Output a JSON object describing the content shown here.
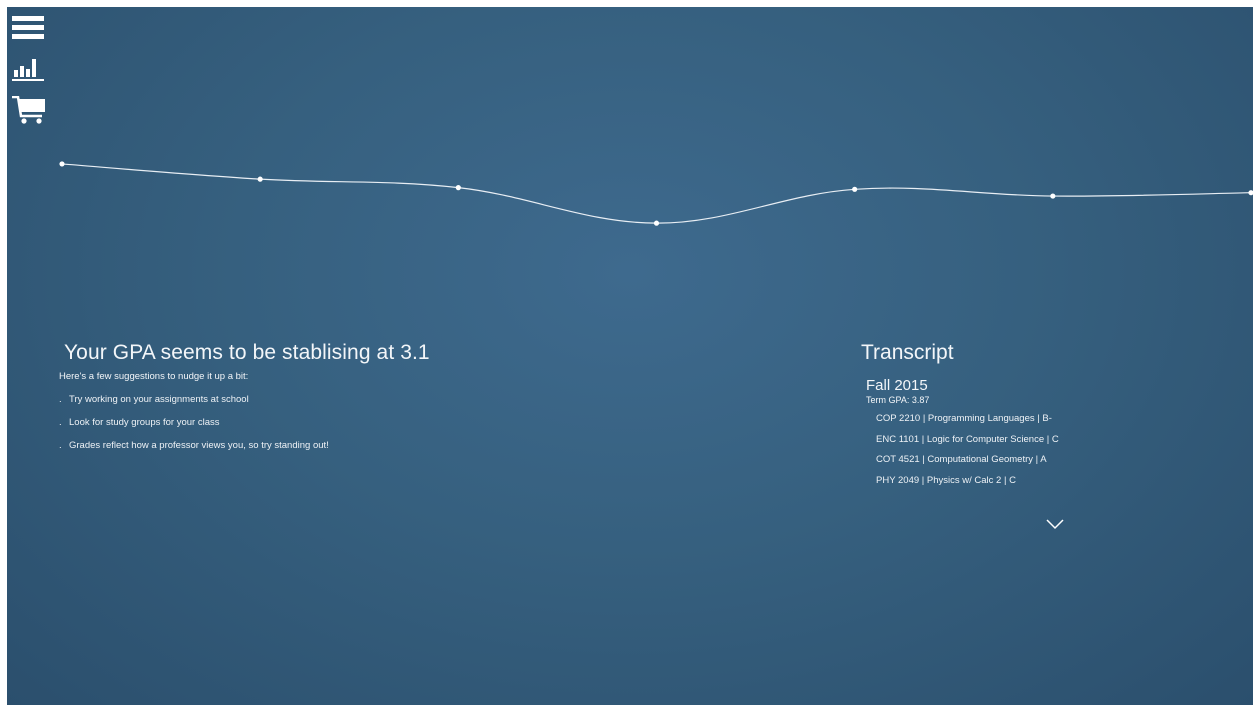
{
  "nav": {
    "icons": [
      "menu-icon",
      "bar-chart-icon",
      "shopping-cart-icon"
    ]
  },
  "chart_data": {
    "type": "line",
    "title": "",
    "xlabel": "",
    "ylabel": "",
    "x": [
      1,
      2,
      3,
      4,
      5,
      6,
      7
    ],
    "series": [
      {
        "values": [
          3.45,
          3.36,
          3.31,
          3.1,
          3.3,
          3.26,
          3.28
        ]
      }
    ],
    "ylim": [
      2.9,
      3.55
    ],
    "smooth": true,
    "axes_visible": false,
    "grid": false,
    "line_color": "#e8eef4"
  },
  "insights": {
    "headline": "Your GPA seems to be stablising at 3.1",
    "intro": "Here's a few suggestions to nudge it up a bit:",
    "bullet_char": ".",
    "suggestions": [
      "Try working on your assignments at school",
      "Look for study groups for your class",
      "Grades reflect how a professor views you, so try standing out!"
    ]
  },
  "transcript": {
    "title": "Transcript",
    "term": {
      "name": "Fall 2015",
      "gpa_label": "Term GPA: 3.87",
      "courses": [
        "COP 2210 | Programming Languages | B-",
        "ENC 1101 | Logic for Computer Science | C",
        "COT 4521 | Computational Geometry | A",
        "PHY 2049 | Physics w/ Calc 2 | C"
      ]
    },
    "expand_icon": "chevron-down-icon"
  },
  "colors": {
    "background": "#3a6488",
    "foreground": "#ffffff"
  }
}
